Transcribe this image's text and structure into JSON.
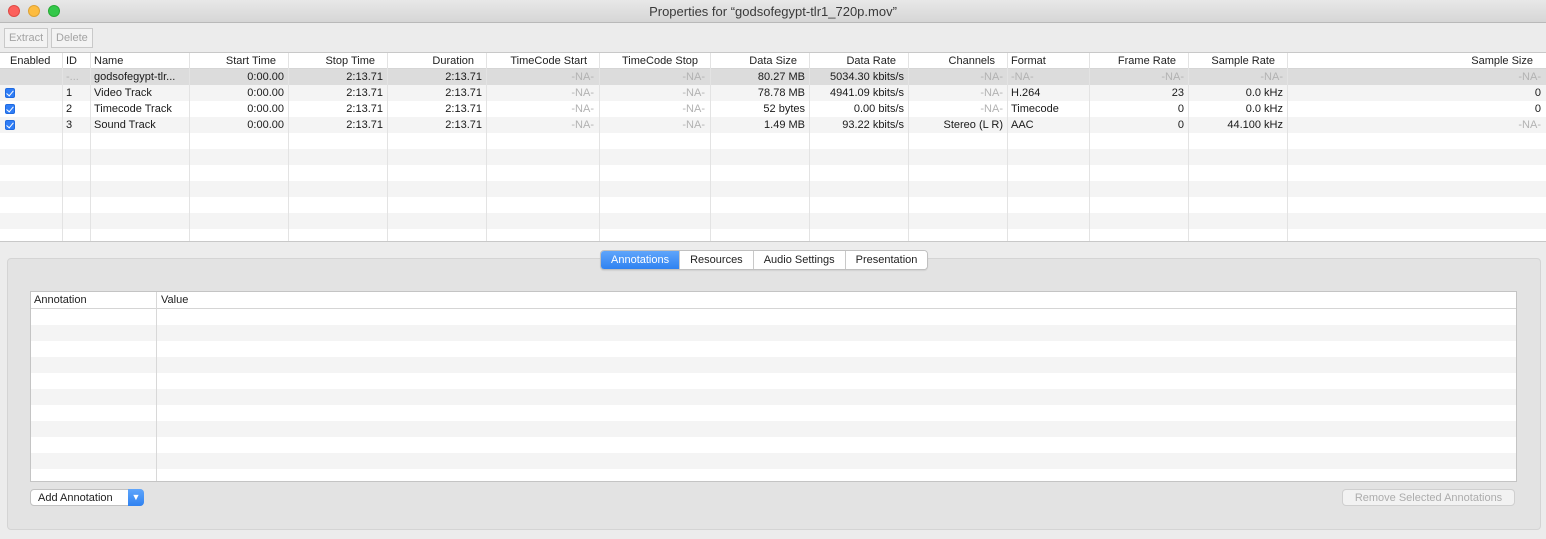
{
  "window": {
    "title": "Properties for “godsofegypt-tlr1_720p.mov”"
  },
  "toolbar": {
    "extract_label": "Extract",
    "delete_label": "Delete"
  },
  "tracks": {
    "columns": {
      "enabled": "Enabled",
      "id": "ID",
      "name": "Name",
      "start": "Start Time",
      "stop": "Stop Time",
      "duration": "Duration",
      "tc_start": "TimeCode Start",
      "tc_stop": "TimeCode Stop",
      "data_size": "Data Size",
      "data_rate": "Data Rate",
      "channels": "Channels",
      "format": "Format",
      "frame_rate": "Frame Rate",
      "sample_rate": "Sample Rate",
      "sample_size": "Sample Size"
    },
    "rows": [
      {
        "id": "-...",
        "name": "godsofegypt-tlr...",
        "start": "0:00.00",
        "stop": "2:13.71",
        "duration": "2:13.71",
        "tc_start": "-NA-",
        "tc_stop": "-NA-",
        "data_size": "80.27 MB",
        "data_rate": "5034.30 kbits/s",
        "channels": "-NA-",
        "format": "-NA-",
        "frame_rate": "-NA-",
        "sample_rate": "-NA-",
        "sample_size": "-NA-"
      },
      {
        "id": "1",
        "name": "Video Track",
        "start": "0:00.00",
        "stop": "2:13.71",
        "duration": "2:13.71",
        "tc_start": "-NA-",
        "tc_stop": "-NA-",
        "data_size": "78.78 MB",
        "data_rate": "4941.09 kbits/s",
        "channels": "-NA-",
        "format": "H.264",
        "frame_rate": "23",
        "sample_rate": "0.0 kHz",
        "sample_size": "0"
      },
      {
        "id": "2",
        "name": "Timecode Track",
        "start": "0:00.00",
        "stop": "2:13.71",
        "duration": "2:13.71",
        "tc_start": "-NA-",
        "tc_stop": "-NA-",
        "data_size": "52 bytes",
        "data_rate": "0.00 bits/s",
        "channels": "-NA-",
        "format": "Timecode",
        "frame_rate": "0",
        "sample_rate": "0.0 kHz",
        "sample_size": "0"
      },
      {
        "id": "3",
        "name": "Sound Track",
        "start": "0:00.00",
        "stop": "2:13.71",
        "duration": "2:13.71",
        "tc_start": "-NA-",
        "tc_stop": "-NA-",
        "data_size": "1.49 MB",
        "data_rate": "93.22 kbits/s",
        "channels": "Stereo (L R)",
        "format": "AAC",
        "frame_rate": "0",
        "sample_rate": "44.100 kHz",
        "sample_size": "-NA-"
      }
    ]
  },
  "tabs": {
    "annotations": "Annotations",
    "resources": "Resources",
    "audio_settings": "Audio Settings",
    "presentation": "Presentation"
  },
  "annotations": {
    "col_annotation": "Annotation",
    "col_value": "Value"
  },
  "footer": {
    "add_annotation": "Add Annotation",
    "remove_selected": "Remove Selected Annotations"
  },
  "colors": {
    "accent": "#2f82f1",
    "stripe": "#f4f4f4"
  }
}
